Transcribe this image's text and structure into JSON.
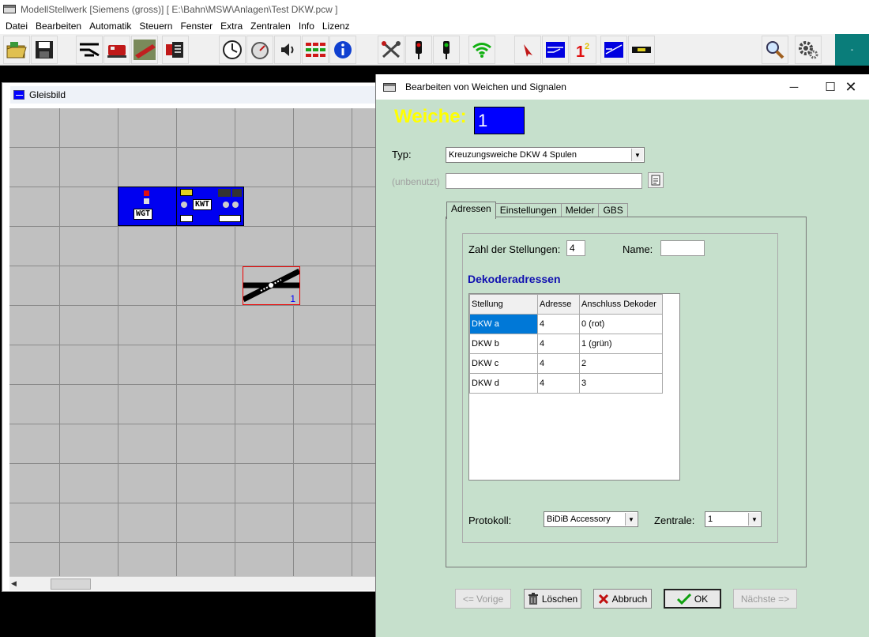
{
  "app": {
    "title": "ModellStellwerk [Siemens (gross)]  [ E:\\Bahn\\MSW\\Anlagen\\Test DKW.pcw ]"
  },
  "menu": [
    "Datei",
    "Bearbeiten",
    "Automatik",
    "Steuern",
    "Fenster",
    "Extra",
    "Zentralen",
    "Info",
    "Lizenz"
  ],
  "toolbar": {
    "icons": [
      "open-icon",
      "save-icon",
      "switch-edit-icon",
      "locomotive-icon",
      "train-icon",
      "list-icon",
      "clock-icon",
      "stopwatch-icon",
      "speaker-icon",
      "matrix-icon",
      "info-icon",
      "tools-icon",
      "signal-red-icon",
      "signal-green-icon",
      "wifi-icon",
      "pointer-icon",
      "track-icon",
      "sequence-icon",
      "track-plan-icon",
      "block-icon",
      "zoom-icon",
      "settings-icon"
    ],
    "status_text": "-"
  },
  "gleisbild": {
    "title": "Gleisbild",
    "elements": [
      {
        "label": "WGT"
      },
      {
        "label": "KWT"
      }
    ],
    "dkw_number": "1"
  },
  "dialog": {
    "title": "Bearbeiten von Weichen und Signalen",
    "weiche_label": "Weiche:",
    "weiche_number": "1",
    "typ_label": "Typ:",
    "typ_value": "Kreuzungsweiche DKW 4 Spulen",
    "unbenutzt_label": "(unbenutzt)",
    "unbenutzt_value": "",
    "tabs": [
      "Adressen",
      "Einstellungen",
      "Melder",
      "GBS"
    ],
    "active_tab": "Adressen",
    "adressen": {
      "zahl_label": "Zahl der Stellungen:",
      "zahl_value": "4",
      "name_label": "Name:",
      "name_value": "",
      "dekoder_heading": "Dekoderadressen",
      "columns": [
        "Stellung",
        "Adresse",
        "Anschluss Dekoder"
      ],
      "rows": [
        {
          "stellung": "DKW a",
          "adresse": "4",
          "anschluss": "0 (rot)"
        },
        {
          "stellung": "DKW b",
          "adresse": "4",
          "anschluss": "1 (grün)"
        },
        {
          "stellung": "DKW c",
          "adresse": "4",
          "anschluss": "2"
        },
        {
          "stellung": "DKW d",
          "adresse": "4",
          "anschluss": "3"
        }
      ],
      "protokoll_label": "Protokoll:",
      "protokoll_value": "BiDiB Accessory",
      "zentrale_label": "Zentrale:",
      "zentrale_value": "1"
    },
    "buttons": {
      "vorige": "<= Vorige",
      "loeschen": "Löschen",
      "abbruch": "Abbruch",
      "ok": "OK",
      "naechste": "Nächste =>"
    }
  },
  "colors": {
    "dialog_bg": "#c6e0cc",
    "weiche_label": "#ffff00",
    "weiche_box": "#0000ff",
    "selection": "#0078d7",
    "heading_blue": "#1010b0",
    "element_blue": "#0000f0"
  }
}
